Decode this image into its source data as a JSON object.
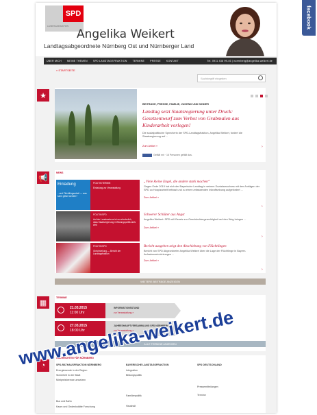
{
  "facebook_tab": "facebook",
  "header": {
    "logo_text": "SPD",
    "logo_small": "LANDTAGSFRAKTION",
    "name": "Angelika Weikert",
    "subtitle": "Landtagsabgeordnete Nürnberg Ost und Nürnberger Land"
  },
  "nav": {
    "items": [
      "Über mich",
      "Meine Themen",
      "SPD Landtagsfraktion",
      "Termine",
      "Presse",
      "Kontakt"
    ],
    "contact": "Tel. 0911 438 99-46 | nuernberg@angelika-weikert.de"
  },
  "breadcrumb": "« STARTSEITE",
  "search": {
    "placeholder": "Suchbegriff eingeben"
  },
  "feature": {
    "kicker": "BEITRÄGE, PRESSE, FAMILIE, JUGEND UND KINDER",
    "headline": "Landtag setzt Staatsregierung unter Druck: Gesetzentwurf zum Verbot von Grabmalen aus Kinderarbeit vorlegen!",
    "body": "Die sozialpolitische Sprecherin der SPD-Landtagsfraktion, Angelika Weikert, fordert die Staatsregierung auf ...",
    "more": "Zum Artikel »",
    "like_text": "Gefällt mir  · 16 Personen gefällt das."
  },
  "news": {
    "section": "NEWS",
    "thumbs": [
      {
        "left_text": "Einladung",
        "left_sub": "...und Flüchtlingsarbeit — was kann getan werden?",
        "label": "POLITIK/TERMIN",
        "title": "Einladung zur Veranstaltung"
      },
      {
        "left_text": "",
        "left_sub": "",
        "label": "POLITIK/SPD",
        "title": "Auf der Landesebene ist es erforderlich, dass Staatsregierung in Bildungspolitik aktiv wird"
      },
      {
        "left_text": "",
        "left_sub": "",
        "label": "POLITIK/SPD",
        "title": "Gleichstellung — Bericht der Landtagsfraktion"
      }
    ],
    "articles": [
      {
        "title": "„Viele kleine Engel, die andere stark machen“",
        "body": "Gegen Ende 2015 hat sich der Bayerische Landtag in seinem Sozialausschuss mit den Anträgen der SPD zu Hospizarbeit befasst und zu einer umfassenden Inkraftsetzung aufgefordert ...",
        "more": "Zum Artikel »"
      },
      {
        "title": "Schwerer Schlüter aus Angst",
        "body": "Angelika Weikert: SPD will Gesetz zur Geschlechtergerechtigkeit auf den Weg bringen ...",
        "more": "Zum Artikel »"
      },
      {
        "title": "Bericht ausgeben zeigt den Abschiebung von Flüchtlingen",
        "body": "Bericht von SPD Abgeordneter Angelika Weikert über die Lage der Flüchtlinge in Bayern. Aufnahmeeinrichtungen ...",
        "more": "Zum Artikel »"
      }
    ],
    "all_button": "WEITERE BEITRÄGE ANZEIGEN"
  },
  "termine": {
    "section": "TERMINE",
    "events": [
      {
        "date": "21.03.2015",
        "time": "11:00 Uhr",
        "title": "INFORMATIONSSTAND",
        "link": "zur Veranstaltung »"
      },
      {
        "date": "27.03.2015",
        "time": "18:00 Uhr",
        "title": "JAHRESHAUPTVERSAMMLUNG SPD NÜRNBERG",
        "link": "zur Veranstaltung »"
      }
    ],
    "all_button": "ALLE TERMINE ANZEIGEN"
  },
  "footer": {
    "section": "NACHRICHTEN FÜR NÜRNBERG",
    "columns": [
      {
        "title": "SPD-RATHAUSFRAKTION NÜRNBERG",
        "links": [
          "Energiewende in der Region",
          "Sicherheit in der Stadt",
          "Mietpreisbremse umsetzen",
          "Schulen sanieren",
          "Bus und Bahn",
          "Kaum und Gedenkstätte Forschung"
        ]
      },
      {
        "title": "BAYERISCHE LANDTAGSFRAKTION",
        "links": [
          "Integration",
          "Bildungspolitik",
          "Hochschule und Forschung",
          "Familienpolitik",
          "Haushalt"
        ]
      },
      {
        "title": "SPD DEUTSCHLAND",
        "links": [
          "Pressemitteilungen",
          "Termine",
          "Aktuelles"
        ]
      }
    ]
  },
  "watermark": "www.angelika-weikert.de",
  "colors": {
    "accent": "#c4112f",
    "spd_red": "#e3000f",
    "nav_bg": "#2b2b2b",
    "watermark": "#1c3f98"
  }
}
